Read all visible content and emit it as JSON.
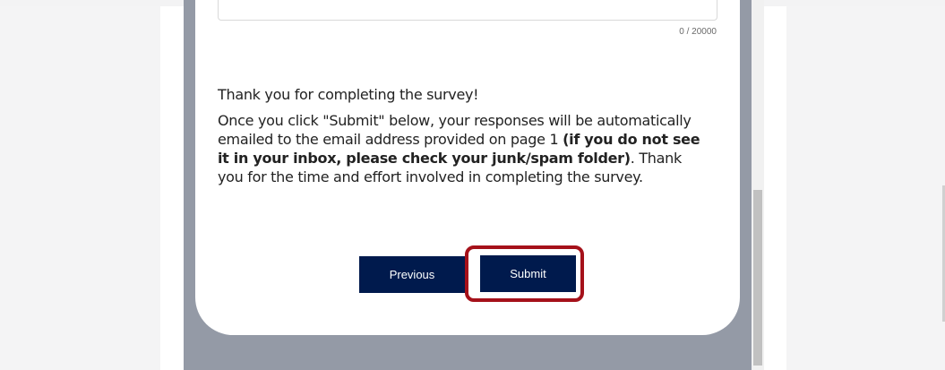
{
  "survey": {
    "char_counter": "0 / 20000",
    "thanks_heading": "Thank you for completing the survey!",
    "body_intro": "Once you click \"Submit\" below, your responses will be automatically emailed to the email address provided on page 1 ",
    "body_bold": "(if you do not see it in your inbox, please check your junk/spam folder)",
    "body_outro": ". Thank you for the time and effort involved in completing the survey."
  },
  "buttons": {
    "previous_label": "Previous",
    "submit_label": "Submit"
  },
  "colors": {
    "button_bg": "#001a4d",
    "highlight": "#a5111a",
    "frame_bg": "#949aa6"
  }
}
